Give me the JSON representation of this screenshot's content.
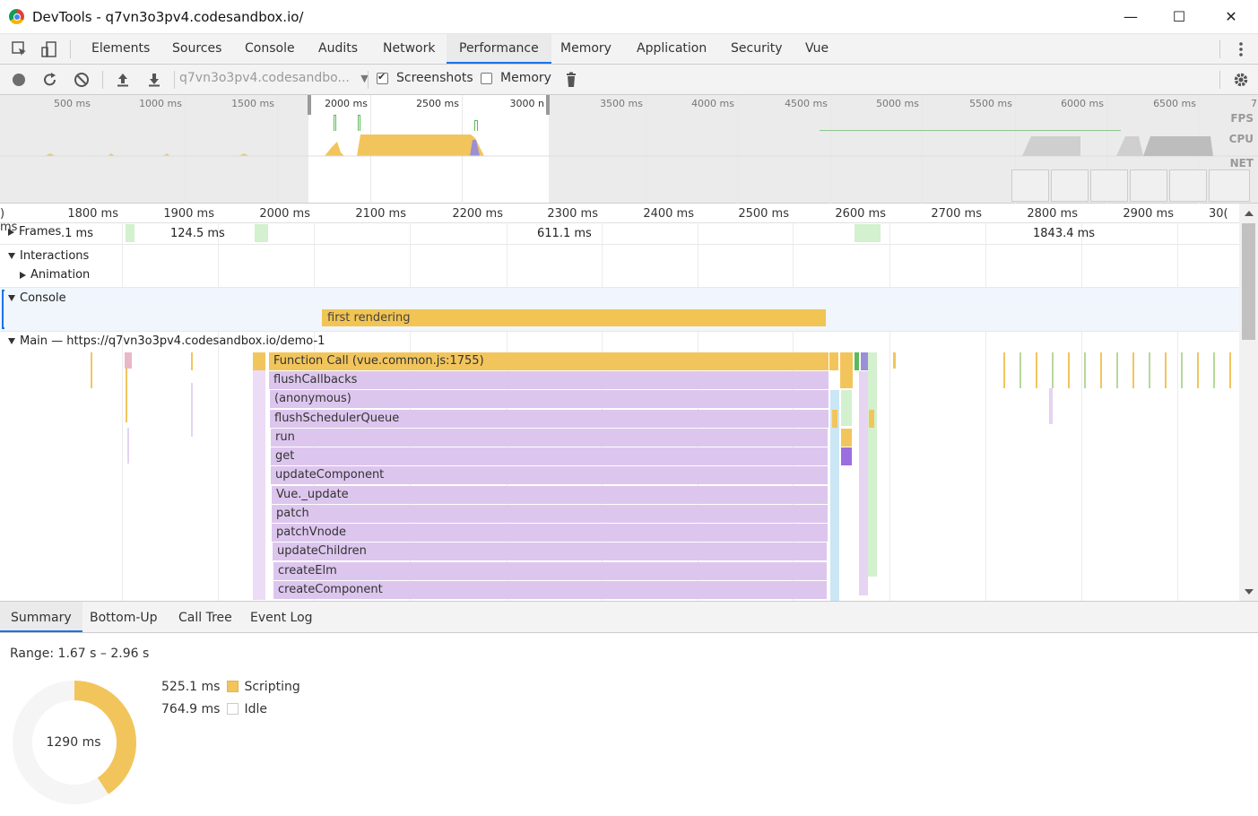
{
  "window": {
    "title": "DevTools - q7vn3o3pv4.codesandbox.io/",
    "minimize": "—",
    "maximize": "☐",
    "close": "✕"
  },
  "tabs": [
    "Elements",
    "Sources",
    "Console",
    "Audits",
    "Network",
    "Performance",
    "Memory",
    "Application",
    "Security",
    "Vue"
  ],
  "active_tab": "Performance",
  "toolbar": {
    "url_select": "q7vn3o3pv4.codesandbo...",
    "screenshots_label": "Screenshots",
    "screenshots_checked": true,
    "memory_label": "Memory",
    "memory_checked": false
  },
  "overview": {
    "ticks": [
      "500 ms",
      "1000 ms",
      "1500 ms",
      "2000 ms",
      "2500 ms",
      "3000 n",
      "3500 ms",
      "4000 ms",
      "4500 ms",
      "5000 ms",
      "5500 ms",
      "6000 ms",
      "6500 ms",
      "7"
    ],
    "labels": {
      "fps": "FPS",
      "cpu": "CPU",
      "net": "NET"
    }
  },
  "timeline": {
    "ticks": [
      ") ms",
      "1800 ms",
      "1900 ms",
      "2000 ms",
      "2100 ms",
      "2200 ms",
      "2300 ms",
      "2400 ms",
      "2500 ms",
      "2600 ms",
      "2700 ms",
      "2800 ms",
      "2900 ms",
      "30("
    ],
    "tracks": {
      "frames": "Frames",
      "interactions": "Interactions",
      "animation": "Animation",
      "console": "Console",
      "main": "Main — https://q7vn3o3pv4.codesandbox.io/demo-1"
    },
    "frame_values": [
      ".1 ms",
      "124.5 ms",
      "611.1 ms",
      "1843.4 ms"
    ],
    "console_event": "first rendering",
    "flame": [
      "Function Call (vue.common.js:1755)",
      "flushCallbacks",
      "(anonymous)",
      "flushSchedulerQueue",
      "run",
      "get",
      "updateComponent",
      "Vue._update",
      "patch",
      "patchVnode",
      "updateChildren",
      "createElm",
      "createComponent"
    ]
  },
  "bottom_tabs": [
    "Summary",
    "Bottom-Up",
    "Call Tree",
    "Event Log"
  ],
  "active_bottom_tab": "Summary",
  "summary": {
    "range": "Range: 1.67 s – 2.96 s",
    "total": "1290 ms",
    "items": [
      {
        "value": "525.1 ms",
        "label": "Scripting",
        "color": "#f2c55c"
      },
      {
        "value": "764.9 ms",
        "label": "Idle",
        "color": "#ffffff"
      }
    ]
  },
  "colors": {
    "accent": "#1a73e8",
    "scripting": "#f2c55c",
    "rendering": "#ddc6ee",
    "frames": "#d3f0cf"
  }
}
